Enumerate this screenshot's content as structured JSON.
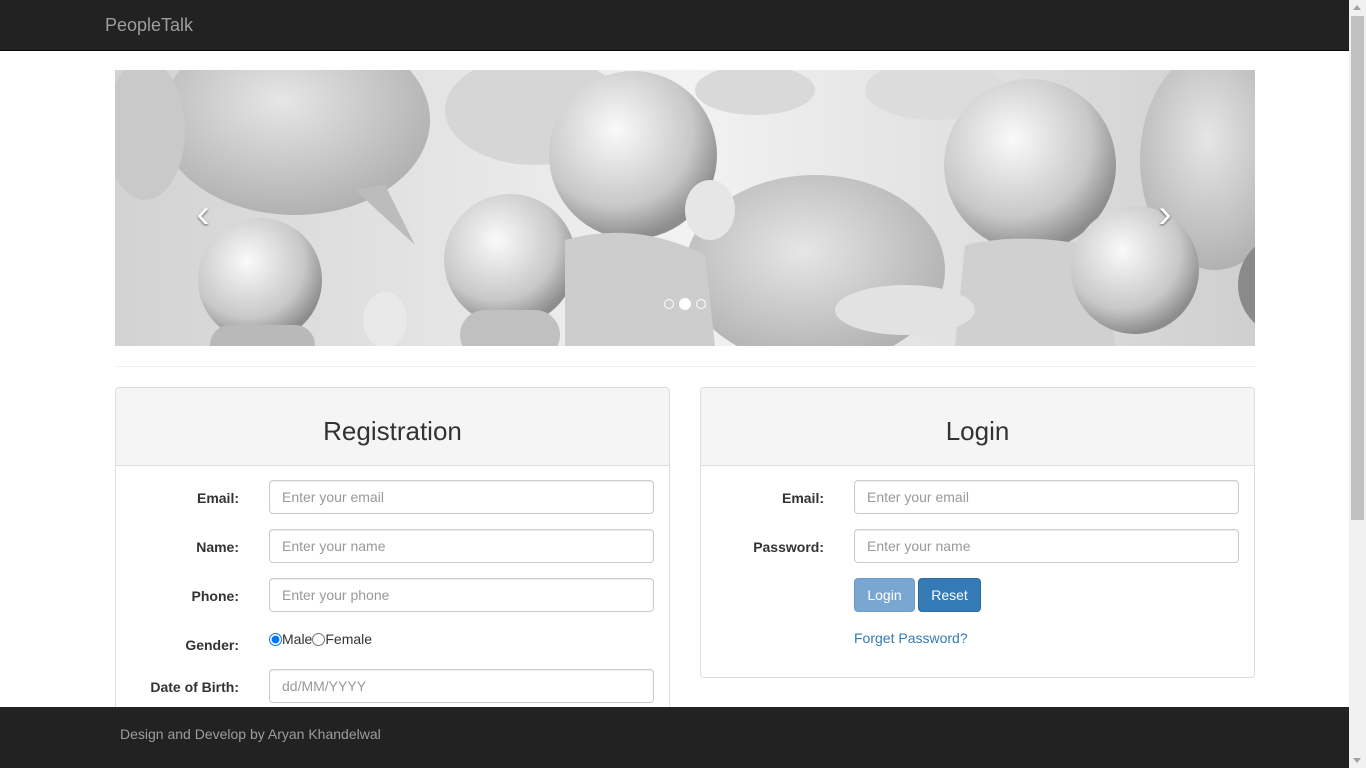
{
  "navbar": {
    "brand": "PeopleTalk"
  },
  "carousel": {
    "prev_glyph": "‹",
    "next_glyph": "›",
    "indicators": 3,
    "active_index": 1
  },
  "registration": {
    "title": "Registration",
    "email_label": "Email:",
    "email_placeholder": "Enter your email",
    "name_label": "Name:",
    "name_placeholder": "Enter your name",
    "phone_label": "Phone:",
    "phone_placeholder": "Enter your phone",
    "gender_label": "Gender:",
    "gender_male": "Male",
    "gender_female": "Female",
    "gender_selected": "Male",
    "dob_label": "Date of Birth:",
    "dob_placeholder": "dd/MM/YYYY"
  },
  "login": {
    "title": "Login",
    "email_label": "Email:",
    "email_placeholder": "Enter your email",
    "password_label": "Password:",
    "password_placeholder": "Enter your name",
    "login_button": "Login",
    "reset_button": "Reset",
    "forgot_link": "Forget Password?"
  },
  "footer": {
    "text": "Design and Develop by Aryan Khandelwal"
  },
  "colors": {
    "navbar_bg": "#222222",
    "brand_text": "#9d9d9d",
    "primary": "#337ab7",
    "panel_heading_bg": "#f5f5f5"
  },
  "icons": {
    "prev": "chevron-left-icon",
    "next": "chevron-right-icon"
  }
}
